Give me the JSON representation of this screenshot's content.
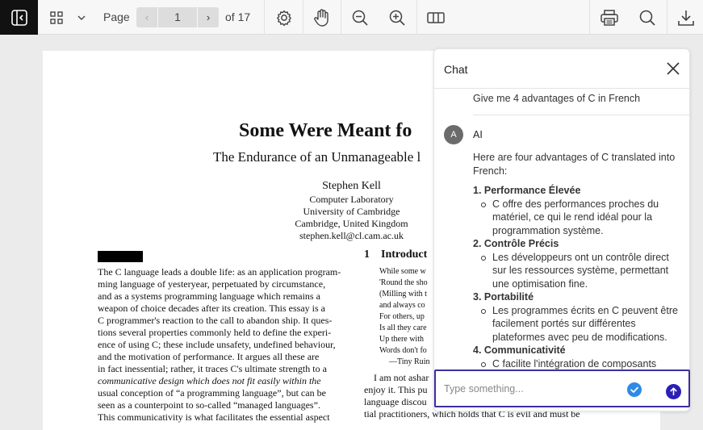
{
  "toolbar": {
    "page_label": "Page",
    "current_page": "1",
    "total_pages": "of 17",
    "prev_glyph": "‹",
    "next_glyph": "›",
    "icons": [
      "sidebar-toggle-icon",
      "grid-view-icon",
      "chevron-down-icon",
      "settings-icon",
      "pan-hand-icon",
      "zoom-out-icon",
      "zoom-in-icon",
      "two-page-icon",
      "print-icon",
      "search-icon",
      "download-icon"
    ]
  },
  "document": {
    "title": "Some Were Meant fo",
    "subtitle": "The Endurance of an Unmanageable l",
    "author": "Stephen Kell",
    "affiliation": [
      "Computer Laboratory",
      "University of Cambridge",
      "Cambridge, United Kingdom",
      "stephen.kell@cl.cam.ac.uk"
    ],
    "abstract_lines": [
      "The C language leads a double life: as an application program-",
      "ming language of yesteryear, perpetuated by circumstance,",
      "and as a systems programming language which remains a",
      "weapon of choice decades after its creation. This essay is a",
      "C programmer's reaction to the call to abandon ship. It ques-",
      "tions several properties commonly held to define the experi-",
      "ence of using C; these include unsafety, undefined behaviour,",
      "and the motivation of performance. It argues all these are",
      "in fact inessential; rather, it traces C's ultimate strength to a",
      "communicative design which does not fit easily within the",
      "usual conception of “a programming language”, but can be",
      "seen as a counterpoint to so-called “managed languages”.",
      "This communicativity is what facilitates the essential aspect"
    ],
    "section_number": "1",
    "section_title": "Introduct",
    "quote_lines": [
      "While some w",
      "'Round the sho",
      "(Milling with t",
      "and always co",
      "For others, up",
      "Is all they care",
      "Up there with",
      "Words don't fo"
    ],
    "quote_attribution": "—Tiny Ruin",
    "right_body_lines": [
      "I am not ashar",
      "enjoy it. This pu",
      "language discou",
      "tial practitioners, which holds that C is evil and must be"
    ]
  },
  "chat": {
    "title": "Chat",
    "user_message": "Give me 4 advantages of C in French",
    "ai_avatar_letter": "A",
    "ai_name": "AI",
    "ai_intro": "Here are four advantages of C translated into French:",
    "advantages": [
      {
        "title": "1. Performance Élevée",
        "desc": "C offre des performances proches du matériel, ce qui le rend idéal pour la programmation système."
      },
      {
        "title": "2. Contrôle Précis",
        "desc": "Les développeurs ont un contrôle direct sur les ressources système, permettant une optimisation fine."
      },
      {
        "title": "3. Portabilité",
        "desc": "Les programmes écrits en C peuvent être facilement portés sur différentes plateformes avec peu de modifications."
      },
      {
        "title": "4. Communicativité",
        "desc": "C facilite l'intégration de composants"
      }
    ],
    "input_placeholder": "Type something...",
    "colors": {
      "send": "#2b1fb5",
      "check": "#2f8ae6",
      "input_border": "#3c2f9e"
    }
  }
}
